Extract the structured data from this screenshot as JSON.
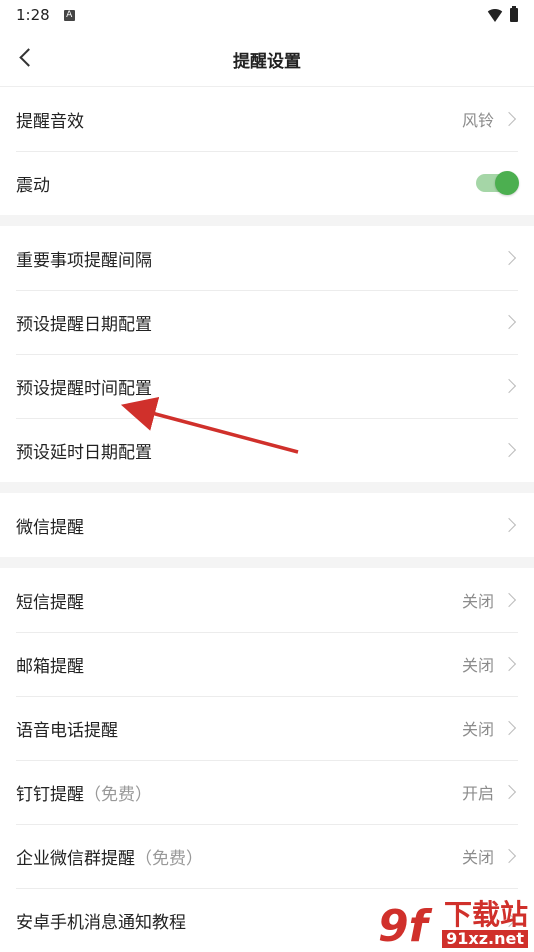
{
  "status_bar": {
    "time": "1:28",
    "notification_icon": "A"
  },
  "header": {
    "title": "提醒设置"
  },
  "groups": [
    [
      {
        "label": "提醒音效",
        "value": "风铃"
      },
      {
        "label": "震动",
        "toggle": true
      }
    ],
    [
      {
        "label": "重要事项提醒间隔"
      },
      {
        "label": "预设提醒日期配置"
      },
      {
        "label": "预设提醒时间配置"
      },
      {
        "label": "预设延时日期配置"
      }
    ],
    [
      {
        "label": "微信提醒"
      }
    ],
    [
      {
        "label": "短信提醒",
        "value": "关闭"
      },
      {
        "label": "邮箱提醒",
        "value": "关闭"
      },
      {
        "label": "语音电话提醒",
        "value": "关闭"
      },
      {
        "label": "钉钉提醒",
        "sub": "（免费）",
        "value": "开启"
      },
      {
        "label": "企业微信群提醒",
        "sub": "（免费）",
        "value": "关闭"
      },
      {
        "label": "安卓手机消息通知教程"
      }
    ]
  ],
  "watermark": {
    "logo_text": "9f",
    "title": "下载站",
    "url": "91xz.net"
  },
  "colors": {
    "toggle_on": "#4caf50",
    "arrow": "#d0302b"
  }
}
